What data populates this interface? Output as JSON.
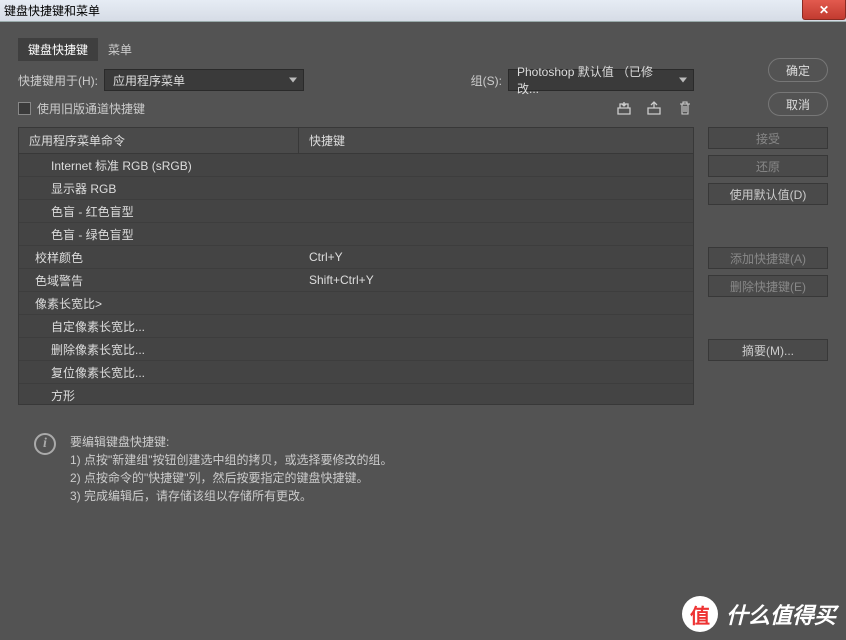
{
  "window": {
    "title": "键盘快捷键和菜单"
  },
  "tabs": {
    "shortcuts": "键盘快捷键",
    "menus": "菜单"
  },
  "shortcutsFor": {
    "label": "快捷键用于(H):",
    "value": "应用程序菜单"
  },
  "set": {
    "label": "组(S):",
    "value": "Photoshop 默认值 （已修改..."
  },
  "legacy": {
    "label": "使用旧版通道快捷键"
  },
  "buttons": {
    "ok": "确定",
    "cancel": "取消"
  },
  "icons": {
    "save": "save-icon",
    "saveAs": "saveas-icon",
    "trash": "trash-icon"
  },
  "table": {
    "col1": "应用程序菜单命令",
    "col2": "快捷键",
    "rows": [
      {
        "cmd": "Internet 标准 RGB (sRGB)",
        "key": "",
        "indent": 1
      },
      {
        "cmd": "显示器 RGB",
        "key": "",
        "indent": 1
      },
      {
        "cmd": "色盲 - 红色盲型",
        "key": "",
        "indent": 1
      },
      {
        "cmd": "色盲 - 绿色盲型",
        "key": "",
        "indent": 1
      },
      {
        "cmd": "校样颜色",
        "key": "Ctrl+Y",
        "indent": 0
      },
      {
        "cmd": "色域警告",
        "key": "Shift+Ctrl+Y",
        "indent": 0
      },
      {
        "cmd": "像素长宽比>",
        "key": "",
        "indent": 0
      },
      {
        "cmd": "自定像素长宽比...",
        "key": "",
        "indent": 1
      },
      {
        "cmd": "删除像素长宽比...",
        "key": "",
        "indent": 1
      },
      {
        "cmd": "复位像素长宽比...",
        "key": "",
        "indent": 1
      },
      {
        "cmd": "方形",
        "key": "",
        "indent": 1
      }
    ]
  },
  "actions": {
    "accept": "接受",
    "undo": "还原",
    "useDefault": "使用默认值(D)",
    "add": "添加快捷键(A)",
    "delete": "删除快捷键(E)",
    "summary": "摘要(M)..."
  },
  "info": {
    "heading": "要编辑键盘快捷键:",
    "line1": "1) 点按\"新建组\"按钮创建选中组的拷贝，或选择要修改的组。",
    "line2": "2) 点按命令的\"快捷键\"列，然后按要指定的键盘快捷键。",
    "line3": "3) 完成编辑后，请存储该组以存储所有更改。"
  },
  "watermark": {
    "badge": "值",
    "text": "什么值得买"
  }
}
